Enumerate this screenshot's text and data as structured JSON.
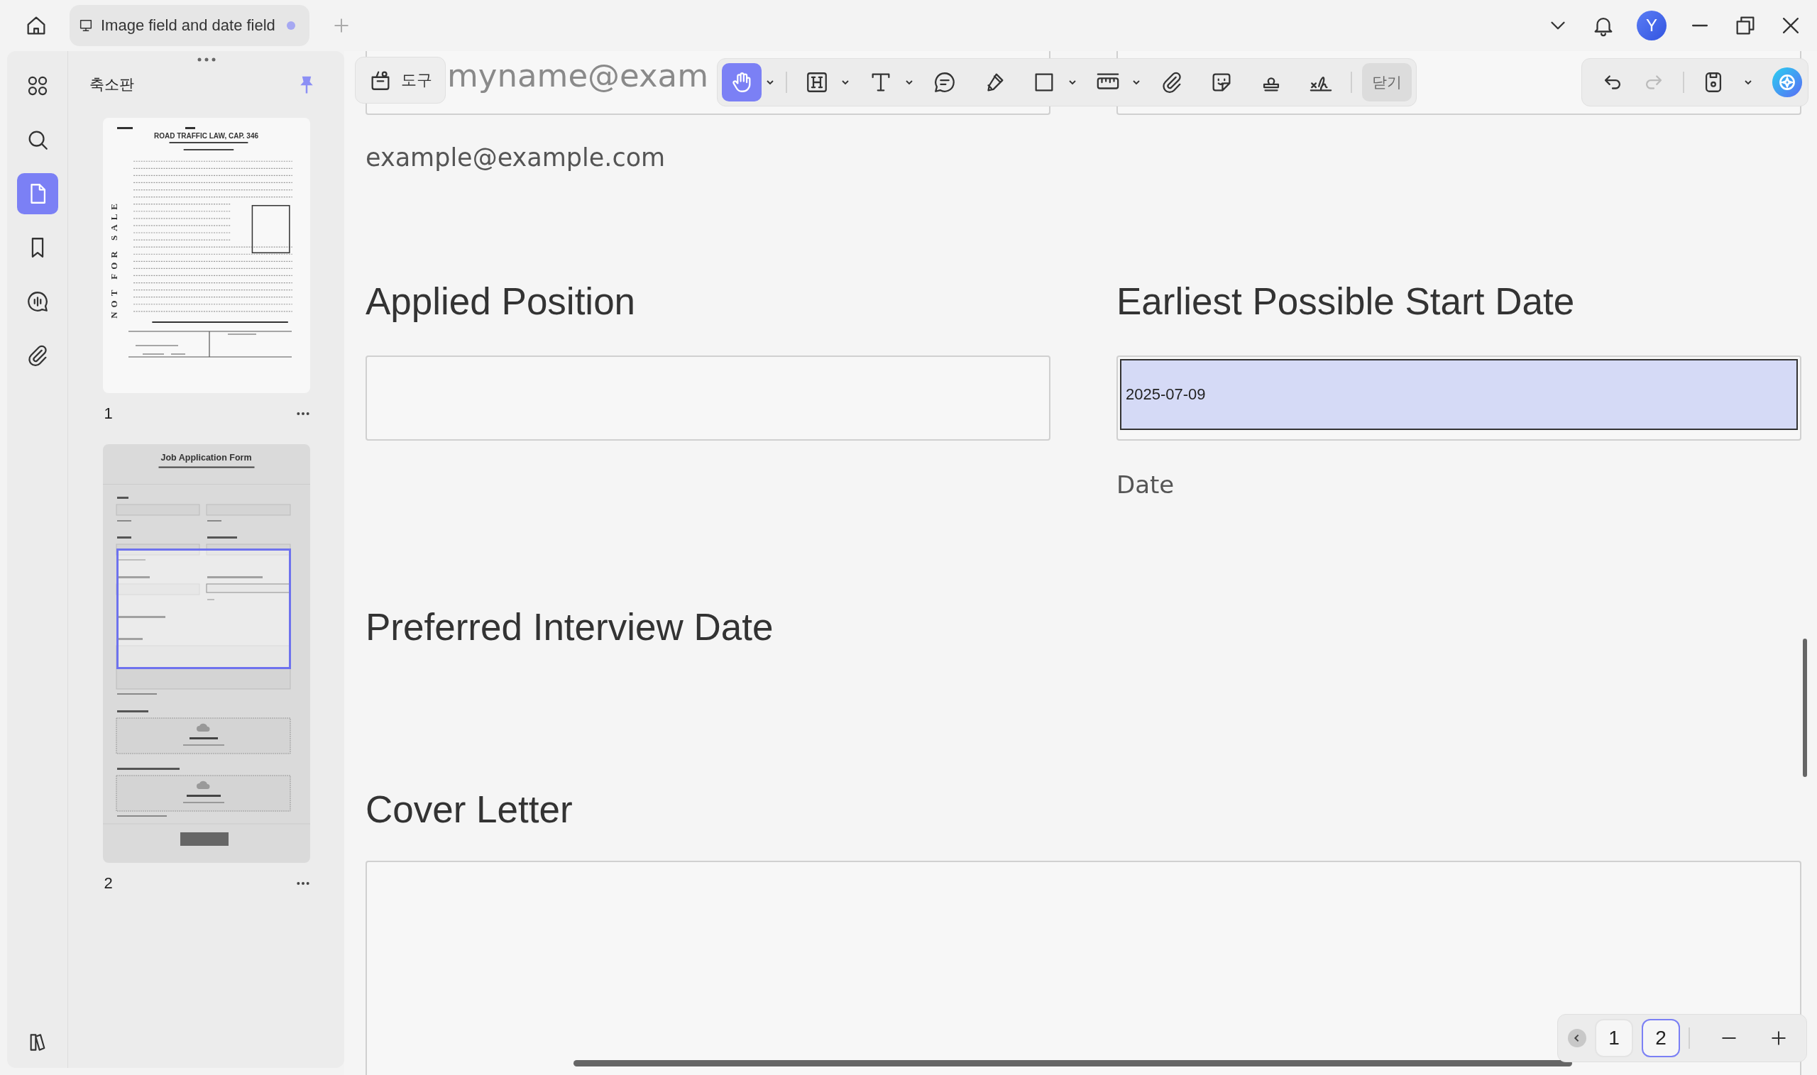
{
  "tab_bar": {
    "tabs": [
      {
        "title": "Image field and date field",
        "unsaved": true,
        "selected": true
      }
    ],
    "avatar": "Y"
  },
  "rail": {
    "items": [
      {
        "kind": "thumbnails",
        "selected": false
      },
      {
        "kind": "search",
        "selected": false
      },
      {
        "kind": "pages",
        "selected": true
      },
      {
        "kind": "bookmarks",
        "selected": false
      },
      {
        "kind": "comments",
        "selected": false
      },
      {
        "kind": "attachments",
        "selected": false
      }
    ]
  },
  "thumbnail_panel": {
    "title": "축소판",
    "pinned": true,
    "pages": [
      {
        "number": "1",
        "kind": "licence",
        "selected": false
      },
      {
        "number": "2",
        "kind": "job_form",
        "selected": true
      }
    ],
    "licence": {
      "title": "ROAD TRAFFIC LAW, CAP. 346",
      "stamp": "NOT FOR SALE"
    },
    "job_form": {
      "title": "Job Application Form"
    }
  },
  "tools_button": "도구",
  "toolbar": {
    "groups": [
      [
        {
          "kind": "hand",
          "selected": true,
          "dropdown": true
        }
      ],
      [
        {
          "kind": "heading",
          "selected": false,
          "dropdown": true
        },
        {
          "kind": "text",
          "selected": false,
          "dropdown": true
        },
        {
          "kind": "comment",
          "selected": false,
          "dropdown": false
        },
        {
          "kind": "pen",
          "selected": false,
          "dropdown": false
        },
        {
          "kind": "rectangle",
          "selected": false,
          "dropdown": true
        },
        {
          "kind": "measure",
          "selected": false,
          "dropdown": true
        },
        {
          "kind": "attach",
          "selected": false,
          "dropdown": false
        },
        {
          "kind": "sticker",
          "selected": false,
          "dropdown": false
        },
        {
          "kind": "stamp",
          "selected": false,
          "dropdown": false
        },
        {
          "kind": "signature",
          "selected": false,
          "dropdown": false
        }
      ]
    ],
    "close_label": "닫기"
  },
  "history": {
    "undo_disabled": false,
    "redo_disabled": true
  },
  "document": {
    "email_placeholder": "myname@exam",
    "email_hint": "example@example.com",
    "position_label": "Applied Position",
    "start_label": "Earliest Possible Start Date",
    "start_value": "2025-07-09",
    "start_focused": true,
    "start_hint": "Date",
    "interview_label": "Preferred Interview Date",
    "cover_label": "Cover Letter"
  },
  "page_nav": {
    "pages": [
      {
        "label": "1",
        "selected": false
      },
      {
        "label": "2",
        "selected": true
      }
    ]
  }
}
